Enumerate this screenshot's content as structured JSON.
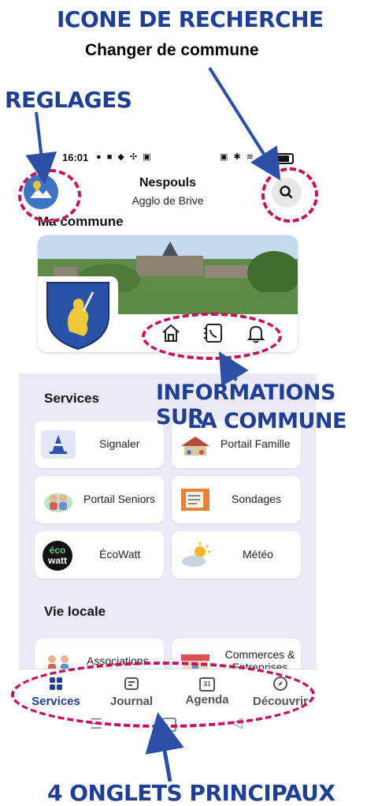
{
  "annotations": {
    "search_title": "ICONE DE RECHERCHE",
    "search_subtitle": "Changer de commune",
    "settings_title": "REGLAGES",
    "info_line1": "INFORMATIONS SUR",
    "info_line2": "LA COMMUNE",
    "tabs_title": "4 ONGLETS PRINCIPAUX"
  },
  "status_bar": {
    "time": "16:01"
  },
  "header": {
    "commune": "Nespouls",
    "agglo": "Agglo de Brive"
  },
  "section_title": "Ma commune",
  "services": {
    "title": "Services",
    "items": [
      {
        "label": "Signaler",
        "icon": "traffic-cone-icon"
      },
      {
        "label": "Portail Famille",
        "icon": "school-icon"
      },
      {
        "label": "Portail Seniors",
        "icon": "seniors-icon"
      },
      {
        "label": "Sondages",
        "icon": "survey-icon"
      },
      {
        "label": "ÉcoWatt",
        "icon": "ecowatt-icon",
        "logo_line1": "éco",
        "logo_line2": "watt"
      },
      {
        "label": "Météo",
        "icon": "weather-icon"
      }
    ]
  },
  "vie_locale": {
    "title": "Vie locale",
    "items": [
      {
        "label": "Associations",
        "icon": "associations-icon"
      },
      {
        "label": "Commerces & Entreprises",
        "icon": "shop-icon"
      }
    ]
  },
  "tabs": [
    {
      "label": "Services",
      "icon": "grid-icon",
      "active": true
    },
    {
      "label": "Journal",
      "icon": "news-icon",
      "active": false
    },
    {
      "label": "Agenda",
      "icon": "calendar-icon",
      "active": false,
      "icon_text": "31"
    },
    {
      "label": "Découvrir",
      "icon": "compass-icon",
      "active": false
    }
  ],
  "colors": {
    "annotation_blue": "#1f3f94",
    "annotation_dash": "#c4125e",
    "panel_bg": "#eceaf6"
  }
}
